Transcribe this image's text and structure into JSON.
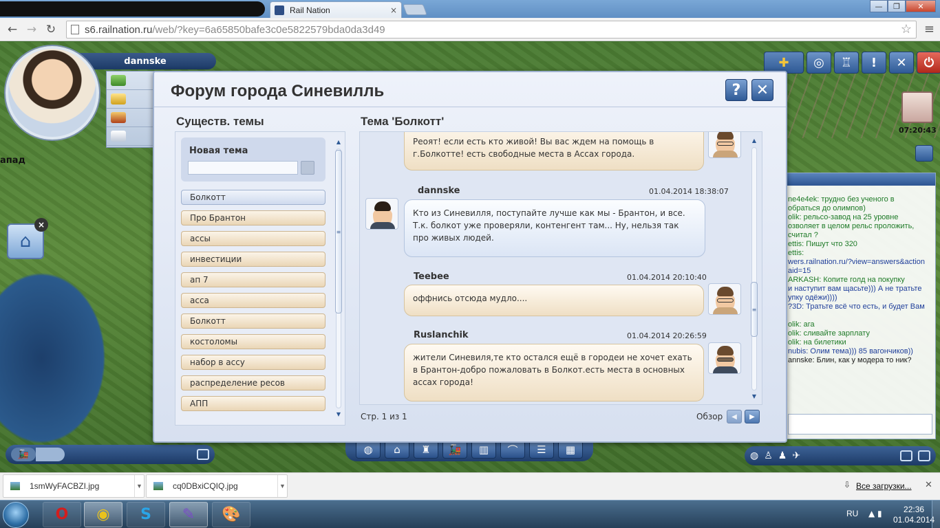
{
  "browser": {
    "tab_title": "Rail Nation",
    "tab_close": "×",
    "window_controls": {
      "minimize": "—",
      "restore": "❐",
      "close": "✕"
    },
    "url_domain": "s6.railnation.ru",
    "url_path": "/web/?key=6a65850bafe3c0e5822579bda0da3d49",
    "back": "←",
    "forward": "→",
    "reload": "↻",
    "star": "☆",
    "menu": "≡"
  },
  "game": {
    "player_name": "dannske",
    "map_label": "апад",
    "clock": "07:20:43",
    "top_tools": [
      "✚",
      "◎",
      "♖",
      "!",
      "✕",
      "⏻"
    ],
    "chat_lines": [
      {
        "t": "ne4e4ek: трудно без ученого в",
        "c": "g"
      },
      {
        "t": "обраться до олимпов)",
        "c": "g"
      },
      {
        "t": "olik: рельсо-завод на 25 уровне",
        "c": "g"
      },
      {
        "t": "озволяет в целом рельс проложить,",
        "c": "g"
      },
      {
        "t": "считал ?",
        "c": "g"
      },
      {
        "t": "ettis: Пишут что 320",
        "c": "g"
      },
      {
        "t": "ettis:",
        "c": "g"
      },
      {
        "t": "wers.railnation.ru/?view=answers&action",
        "c": "b"
      },
      {
        "t": "aid=15",
        "c": "b"
      },
      {
        "t": "ARKASH: Копите голд на покупку",
        "c": "g"
      },
      {
        "t": "и наступит вам щасьте))) А не тратьте",
        "c": "b"
      },
      {
        "t": "упку одёжи))))",
        "c": "b"
      },
      {
        "t": "?3D: Тратьте всё что есть, и будет Вам",
        "c": "b"
      },
      {
        "t": "",
        "c": "g"
      },
      {
        "t": "olik: ага",
        "c": "g"
      },
      {
        "t": "olik: сливайте зарплату",
        "c": "g"
      },
      {
        "t": "olik: на билетики",
        "c": "g"
      },
      {
        "t": "nubis: Олим тема))) 85 вагончиков))",
        "c": "b"
      },
      {
        "t": "annske: Блин, как у модера то ник?",
        "c": ""
      }
    ],
    "bottom_center_tools": [
      "◍",
      "⌂",
      "♜",
      "🚂",
      "▥",
      "⌒",
      "☰",
      "▦"
    ]
  },
  "forum": {
    "title": "Форум города Синевилль",
    "help": "?",
    "close": "✕",
    "topics_heading": "Существ. темы",
    "new_topic_label": "Новая тема",
    "new_topic_placeholder": "",
    "topics": [
      "Болкотт",
      "Про Брантон",
      "ассы",
      "инвестиции",
      "ап 7",
      "асса",
      "Болкотт",
      "костоломы",
      "набор в ассу",
      "распределение ресов",
      "АПП"
    ],
    "thread_heading": "Тема 'Болкотт'",
    "posts": [
      {
        "author": "",
        "date": "",
        "text": "Реоят! если есть кто живой! Вы вас ждем на помощь в г.Болкотте! есть свободные места в Ассах города."
      },
      {
        "author": "dannske",
        "date": "01.04.2014 18:38:07",
        "text": "Кто из Синевилля, поступайте лучше как мы - Брантон, и все. Т.к. болкот уже проверяли, контенгент там... Ну, нельзя так про живых людей."
      },
      {
        "author": "Teebee",
        "date": "01.04.2014 20:10:40",
        "text": "оффнись отсюда мудло...."
      },
      {
        "author": "Ruslanchik",
        "date": "01.04.2014 20:26:59",
        "text": "жители Синевиля,те кто остался ещё в городеи не хочет ехать в Брантон-добро пожаловать в Болкот.есть места в основных ассах города!"
      }
    ],
    "pager": "Стр. 1 из 1",
    "overview": "Обзор",
    "prev": "◀",
    "next": "▶"
  },
  "downloads": {
    "items": [
      "1smWyFACBZI.jpg",
      "cq0DBxiCQIQ.jpg"
    ],
    "all_label": "Все загрузки...",
    "close": "✕"
  },
  "taskbar": {
    "lang": "RU",
    "time": "22:36",
    "date": "01.04.2014"
  }
}
